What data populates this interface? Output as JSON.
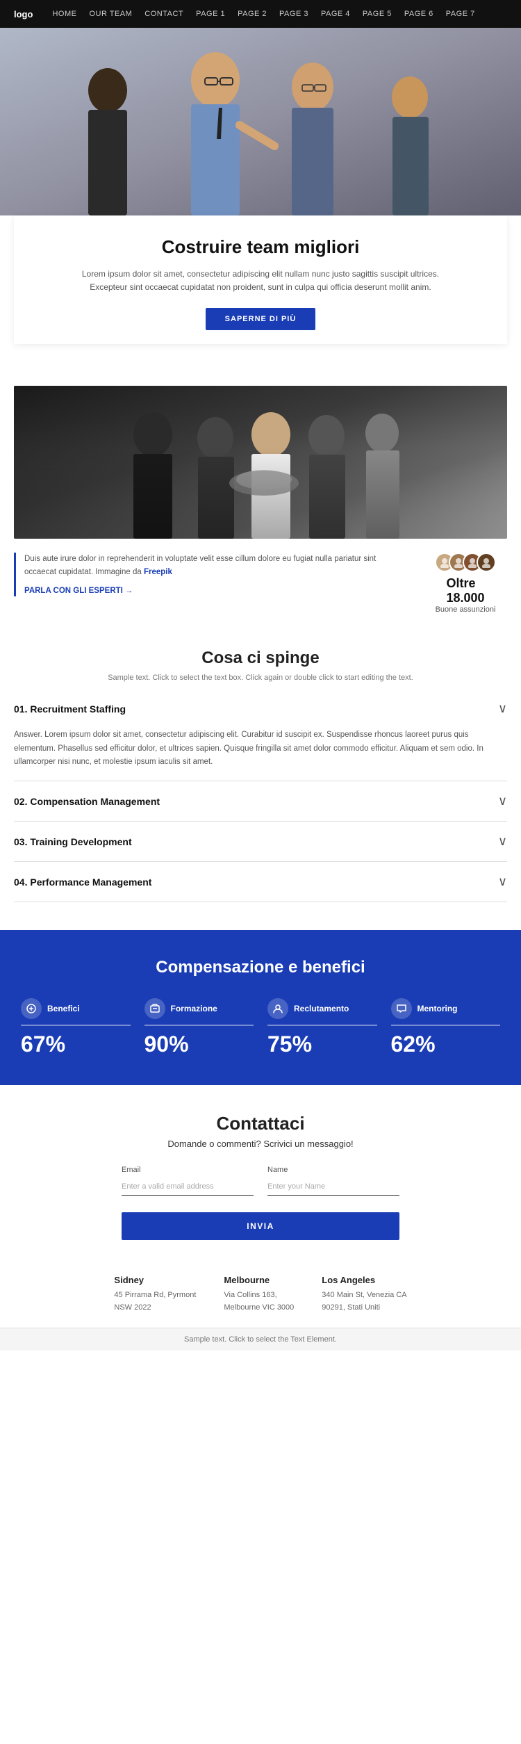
{
  "nav": {
    "logo": "logo",
    "links": [
      "HOME",
      "OUR TEAM",
      "CONTACT",
      "PAGE 1",
      "PAGE 2",
      "PAGE 3",
      "PAGE 4",
      "PAGE 5",
      "PAGE 6",
      "PAGE 7"
    ]
  },
  "hero": {
    "title": "Costruire team migliori",
    "description": "Lorem ipsum dolor sit amet, consectetur adipiscing elit nullam nunc justo sagittis suscipit ultrices. Excepteur sint occaecat cupidatat non proident, sunt in culpa qui officia deserunt mollit anim.",
    "cta_label": "SAPERNE DI PIÙ"
  },
  "team_section": {
    "description": "Duis aute irure dolor in reprehenderit in voluptate velit esse cillum dolore eu fugiat nulla pariatur sint occaecat cupidatat. Immagine da Freepik",
    "link_label": "PARLA CON GLI ESPERTI →",
    "stat_number": "Oltre 18.000",
    "stat_label": "Buone assunzioni"
  },
  "cosa_ci_spinge": {
    "title": "Cosa ci spinge",
    "subtitle": "Sample text. Click to select the text box. Click again or double click to start editing the text.",
    "items": [
      {
        "number": "01.",
        "title": "Recruitment Staffing",
        "open": true,
        "answer": "Answer. Lorem ipsum dolor sit amet, consectetur adipiscing elit. Curabitur id suscipit ex. Suspendisse rhoncus laoreet purus quis elementum. Phasellus sed efficitur dolor, et ultrices sapien. Quisque fringilla sit amet dolor commodo efficitur. Aliquam et sem odio. In ullamcorper nisi nunc, et molestie ipsum iaculis sit amet."
      },
      {
        "number": "02.",
        "title": "Compensation Management",
        "open": false,
        "answer": ""
      },
      {
        "number": "03.",
        "title": "Training Development",
        "open": false,
        "answer": ""
      },
      {
        "number": "04.",
        "title": "Performance Management",
        "open": false,
        "answer": ""
      }
    ]
  },
  "benefici": {
    "title": "Compensazione e benefici",
    "items": [
      {
        "icon": "🏠",
        "label": "Benefici",
        "pct": "67%"
      },
      {
        "icon": "📚",
        "label": "Formazione",
        "pct": "90%"
      },
      {
        "icon": "👥",
        "label": "Reclutamento",
        "pct": "75%"
      },
      {
        "icon": "💬",
        "label": "Mentoring",
        "pct": "62%"
      }
    ]
  },
  "contact": {
    "title": "Contattaci",
    "subtitle": "Domande o commenti? Scrivici un messaggio!",
    "email_label": "Email",
    "email_placeholder": "Enter a valid email address",
    "name_label": "Name",
    "name_placeholder": "Enter your Name",
    "submit_label": "INVIA"
  },
  "offices": [
    {
      "city": "Sidney",
      "address": "45 Pirrama Rd, Pyrmont",
      "region": "NSW 2022"
    },
    {
      "city": "Melbourne",
      "address": "Via Collins 163,",
      "region": "Melbourne VIC 3000"
    },
    {
      "city": "Los Angeles",
      "address": "340 Main St, Venezia CA",
      "region": "90291, Stati Uniti"
    }
  ],
  "footer": {
    "text": "Sample text. Click to select the Text Element."
  }
}
